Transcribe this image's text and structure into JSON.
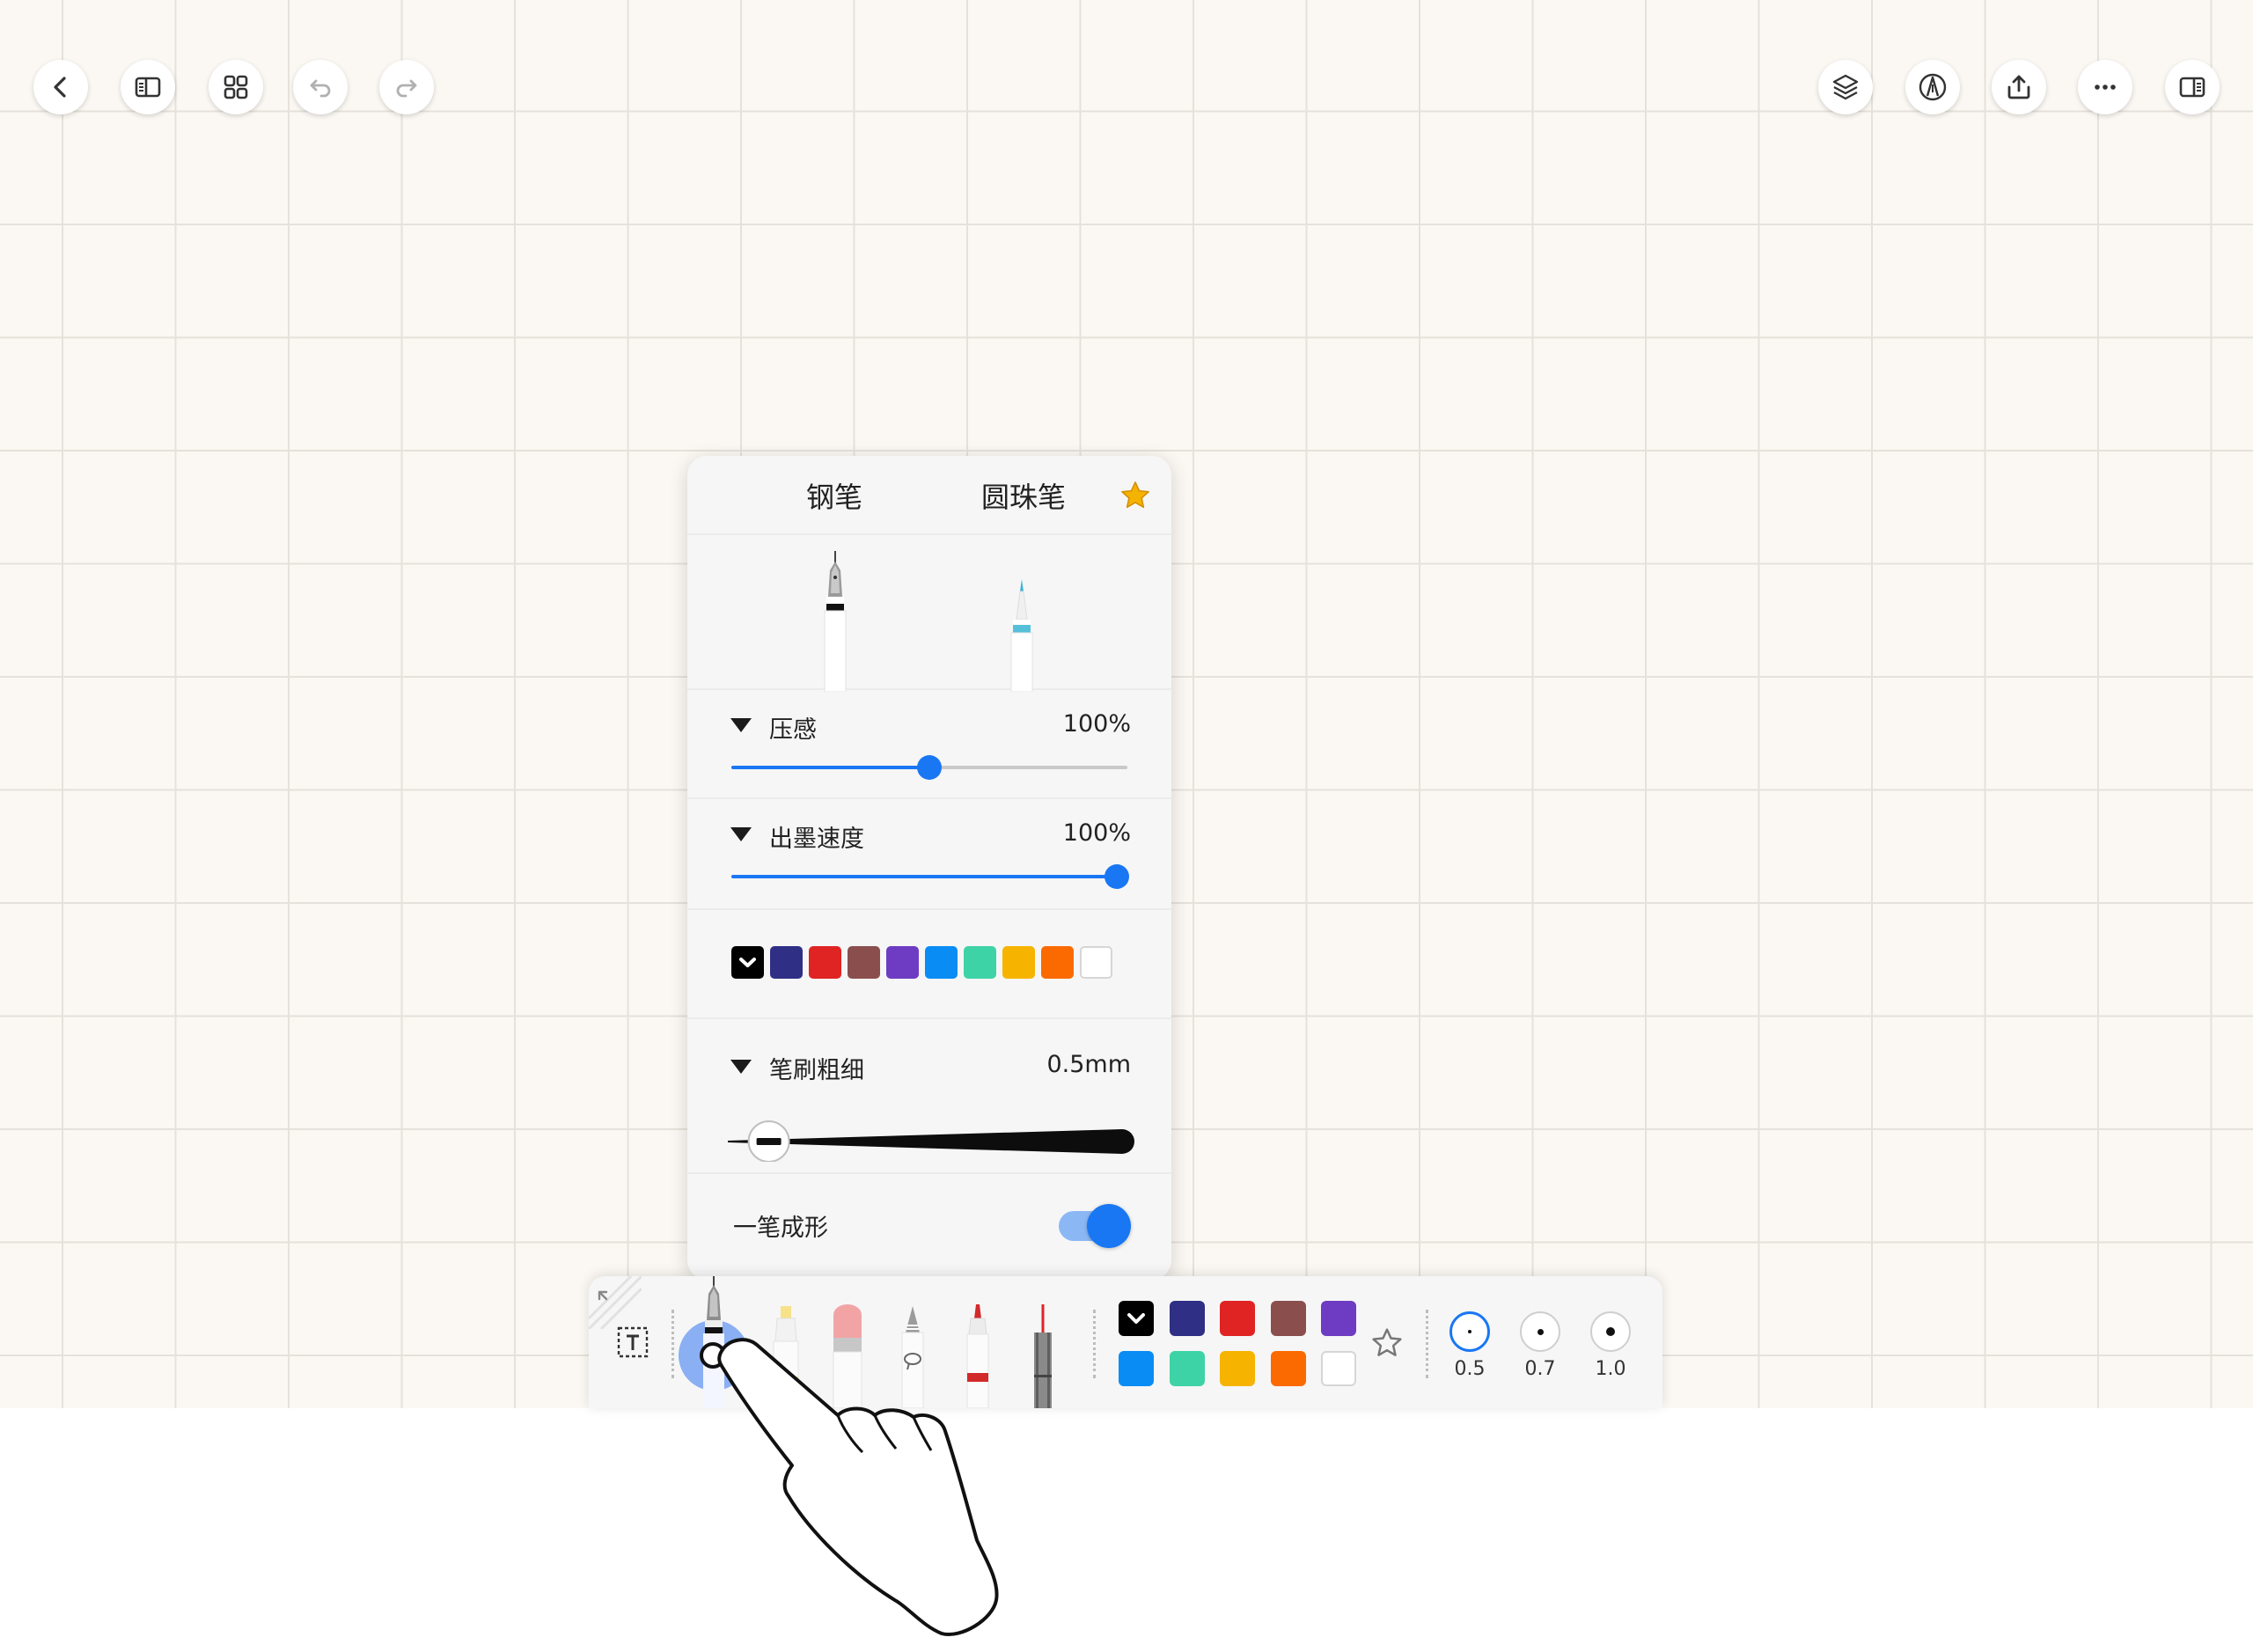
{
  "top_toolbar": {
    "left_buttons": [
      "back-icon",
      "sidebar-toggle-icon",
      "grid-view-icon",
      "undo-icon",
      "redo-icon"
    ],
    "right_buttons": [
      "layers-icon",
      "pen-nib-icon",
      "share-icon",
      "more-icon",
      "split-view-icon"
    ]
  },
  "pen_panel": {
    "tabs": [
      "钢笔",
      "圆珠笔"
    ],
    "favorite_icon": "star-filled-icon",
    "favorite_color": "#f5b301",
    "pressure": {
      "label": "压感",
      "value": "100%",
      "level": 0.5
    },
    "ink_speed": {
      "label": "出墨速度",
      "value": "100%",
      "level": 1.0
    },
    "colors": [
      "#000000",
      "#2f2f86",
      "#e02424",
      "#8a4f4d",
      "#6d3cc2",
      "#0a8cf5",
      "#3ed3a6",
      "#f6b400",
      "#fb6a00",
      "#ffffff"
    ],
    "selected_color": "#000000",
    "brush_width": {
      "label": "笔刷粗细",
      "value": "0.5mm",
      "level": 0.14
    },
    "one_stroke": {
      "label": "一笔成形",
      "enabled": true
    },
    "accent": "#1977f3"
  },
  "bottom_toolbar": {
    "tools": [
      "text-box-icon",
      "fountain-pen-icon",
      "highlighter-icon",
      "eraser-icon",
      "lasso-icon",
      "marker-icon",
      "laser-pointer-icon"
    ],
    "selected_tool": "fountain-pen-icon",
    "colors": [
      "#000000",
      "#2f2f86",
      "#e02424",
      "#8a4f4d",
      "#6d3cc2",
      "#0a8cf5",
      "#3ed3a6",
      "#f6b400",
      "#fb6a00",
      "#ffffff"
    ],
    "sizes": [
      "0.5",
      "0.7",
      "1.0"
    ],
    "selected_size": "0.5"
  }
}
